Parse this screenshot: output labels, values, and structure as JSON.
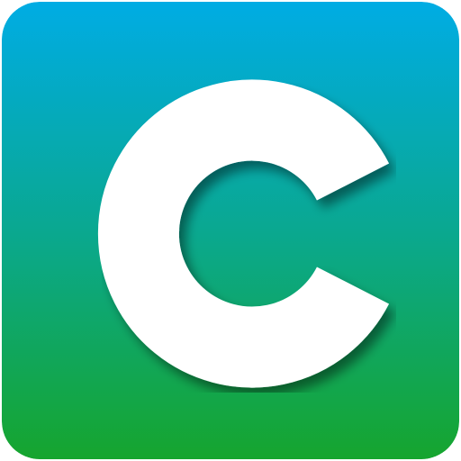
{
  "app_icon": {
    "icon": "letter-c-icon",
    "letter": "C",
    "colors": {
      "gradient_top": "#00ACE4",
      "gradient_mid": "#0AA890",
      "gradient_bottom": "#16A52E",
      "letter_fill": "#FFFFFF",
      "letter_shadow": "#000000"
    }
  }
}
